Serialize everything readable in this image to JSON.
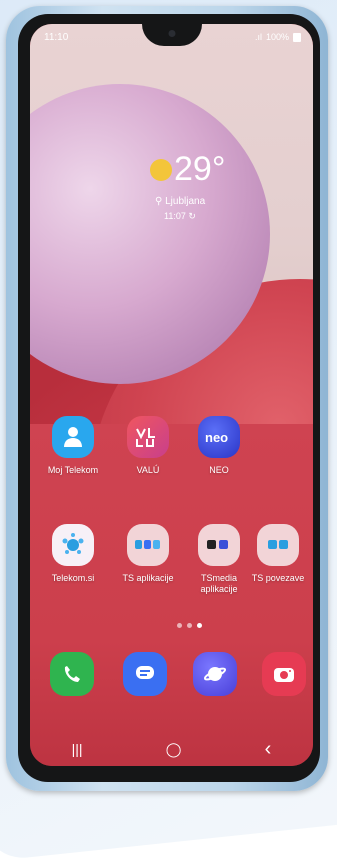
{
  "status_bar": {
    "time": "11:10",
    "battery": "100%"
  },
  "weather": {
    "temperature": "29°",
    "location": "Ljubljana",
    "time": "11:07"
  },
  "apps_row1": [
    {
      "label": "Moj Telekom",
      "icon": "person-icon",
      "color": "#29a7ee"
    },
    {
      "label": "VALÚ",
      "icon": "valu-logo-icon",
      "color": "#e24a6d"
    },
    {
      "label": "NEO",
      "icon": "neo-logo-icon",
      "color": "#3d55e8"
    }
  ],
  "apps_row2": [
    {
      "label": "Telekom.si",
      "icon": "telekom-dots-icon",
      "color": "#f3e6f1"
    },
    {
      "label": "TS aplikacije",
      "icon": "folder-icon",
      "color": "#f4d2d6"
    },
    {
      "label": "TSmedia aplikacije",
      "icon": "folder-icon",
      "color": "#f4d2d6"
    },
    {
      "label": "TS povezave",
      "icon": "folder-icon",
      "color": "#f4d2d6"
    }
  ],
  "dock": [
    {
      "icon": "phone-icon",
      "color": "#2fb44f"
    },
    {
      "icon": "messages-icon",
      "color": "#3a6ff2"
    },
    {
      "icon": "internet-icon",
      "color": "#5e5bf0"
    },
    {
      "icon": "camera-icon",
      "color": "#e63b53"
    }
  ],
  "nav": {
    "recents": "|||",
    "home": "◯",
    "back": "‹"
  }
}
